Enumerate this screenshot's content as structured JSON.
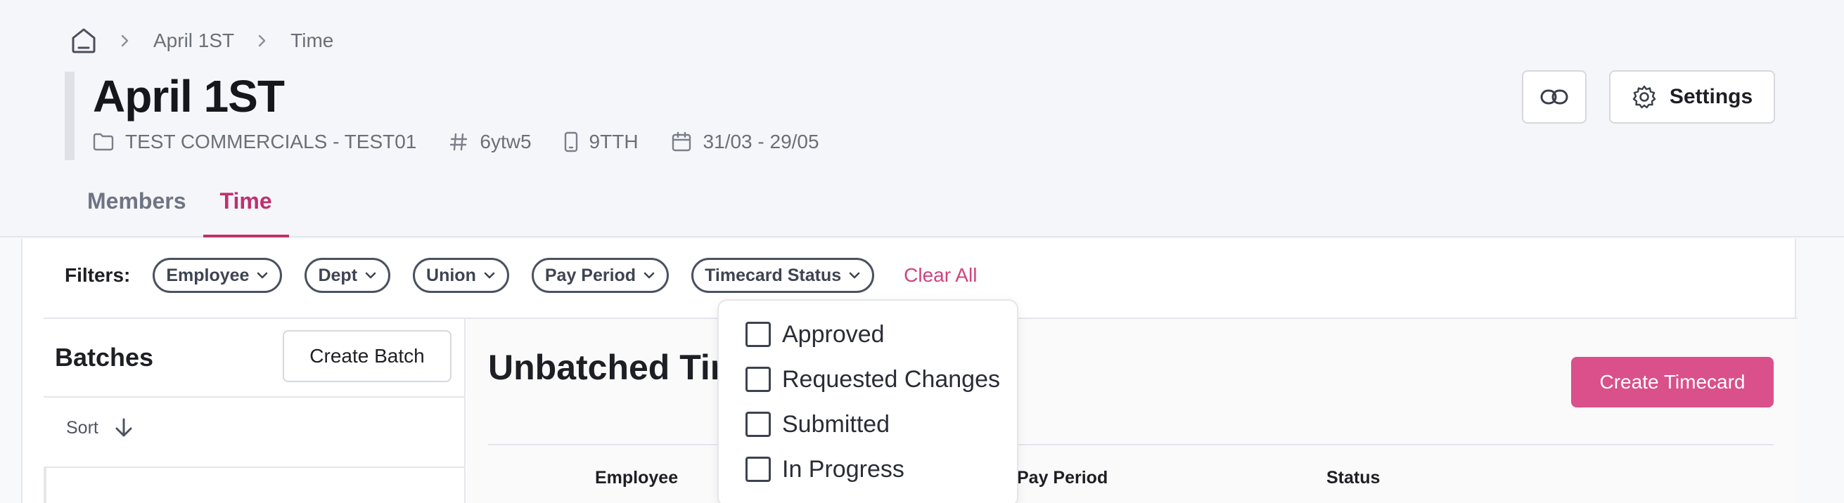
{
  "breadcrumb": {
    "items": [
      "April 1ST",
      "Time"
    ]
  },
  "page": {
    "title": "April 1ST",
    "meta": {
      "project": "TEST COMMERCIALS - TEST01",
      "code": "6ytw5",
      "phone": "9TTH",
      "dates": "31/03 - 29/05"
    }
  },
  "header_actions": {
    "settings_label": "Settings"
  },
  "tabs": [
    {
      "label": "Members",
      "active": false
    },
    {
      "label": "Time",
      "active": true
    }
  ],
  "filters": {
    "label": "Filters:",
    "chips": [
      "Employee",
      "Dept",
      "Union",
      "Pay Period",
      "Timecard Status"
    ],
    "clear_all": "Clear All"
  },
  "batches": {
    "title": "Batches",
    "create_label": "Create Batch",
    "sort_label": "Sort"
  },
  "unbatched": {
    "title": "Unbatched Timecards",
    "create_label": "Create Timecard",
    "columns": [
      "Employee",
      "Pay Period",
      "Status"
    ]
  },
  "status_dropdown": {
    "options": [
      {
        "label": "Approved",
        "checked": false
      },
      {
        "label": "Requested Changes",
        "checked": false
      },
      {
        "label": "Submitted",
        "checked": false
      },
      {
        "label": "In Progress",
        "checked": false
      }
    ]
  },
  "colors": {
    "accent": "#c0306e",
    "primary_button": "#d9508a",
    "clear_all": "#d0437d"
  },
  "icons": {
    "home": "home-icon",
    "folder": "folder-icon",
    "hash": "hash-icon",
    "phone": "phone-icon",
    "calendar": "calendar-icon",
    "link": "link-icon",
    "gear": "gear-icon",
    "chevron": "chevron-down-icon",
    "sort": "arrow-down-icon"
  }
}
